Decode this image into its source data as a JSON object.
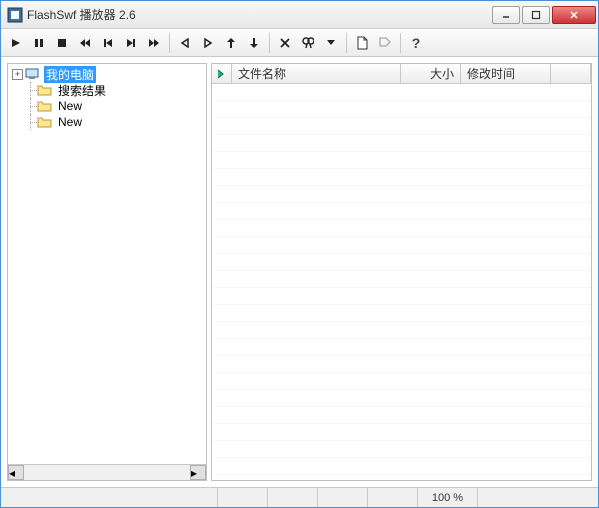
{
  "window": {
    "title": "FlashSwf 播放器 2.6"
  },
  "tree": {
    "root": {
      "label": "我的电脑",
      "selected": true
    },
    "children": [
      {
        "label": "搜索结果"
      },
      {
        "label": "New"
      },
      {
        "label": "New"
      }
    ]
  },
  "table": {
    "headers": {
      "name": "文件名称",
      "size": "大小",
      "date": "修改时间"
    }
  },
  "status": {
    "zoom": "100 %"
  }
}
